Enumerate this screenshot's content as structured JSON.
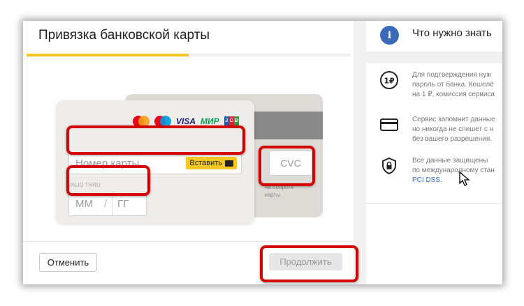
{
  "dialog": {
    "title": "Привязка банковской карты",
    "progress": 0.5
  },
  "card": {
    "number_placeholder": "Номер карты",
    "paste_label": "Вставить",
    "valid_thru": "VALID THRU",
    "month_placeholder": "ММ",
    "slash": "/",
    "year_placeholder": "ГГ",
    "cvc_placeholder": "CVC",
    "cvc_hint_line1": "на обороте",
    "cvc_hint_line2": "карты",
    "brands": {
      "visa": "VISA",
      "mir": "МИР",
      "jcb": [
        "J",
        "C",
        "B"
      ]
    }
  },
  "footer": {
    "cancel_label": "Отменить",
    "continue_label": "Продолжить"
  },
  "info_panel": {
    "icon_text": "i",
    "title": "Что нужно знать",
    "items": [
      {
        "icon": "ruble-coin-icon",
        "icon_text": "1₽",
        "lines": [
          "Для подтверждения нуж",
          "пароль от банка. Кошелё",
          "на 1 ₽, комиссия сервиса"
        ]
      },
      {
        "icon": "card-icon",
        "lines": [
          "Сервис запомнит данные",
          "но никогда не спишет с н",
          "без вашего разрешения."
        ]
      },
      {
        "icon": "shield-lock-icon",
        "lines": [
          "Все данные защищены",
          "по международному стан"
        ],
        "link": "PCI DSS."
      }
    ]
  },
  "colors": {
    "accent_yellow": "#f6c722",
    "highlight_red": "#d40000",
    "info_blue": "#3a6ab8",
    "link_blue": "#2f6ad8"
  }
}
